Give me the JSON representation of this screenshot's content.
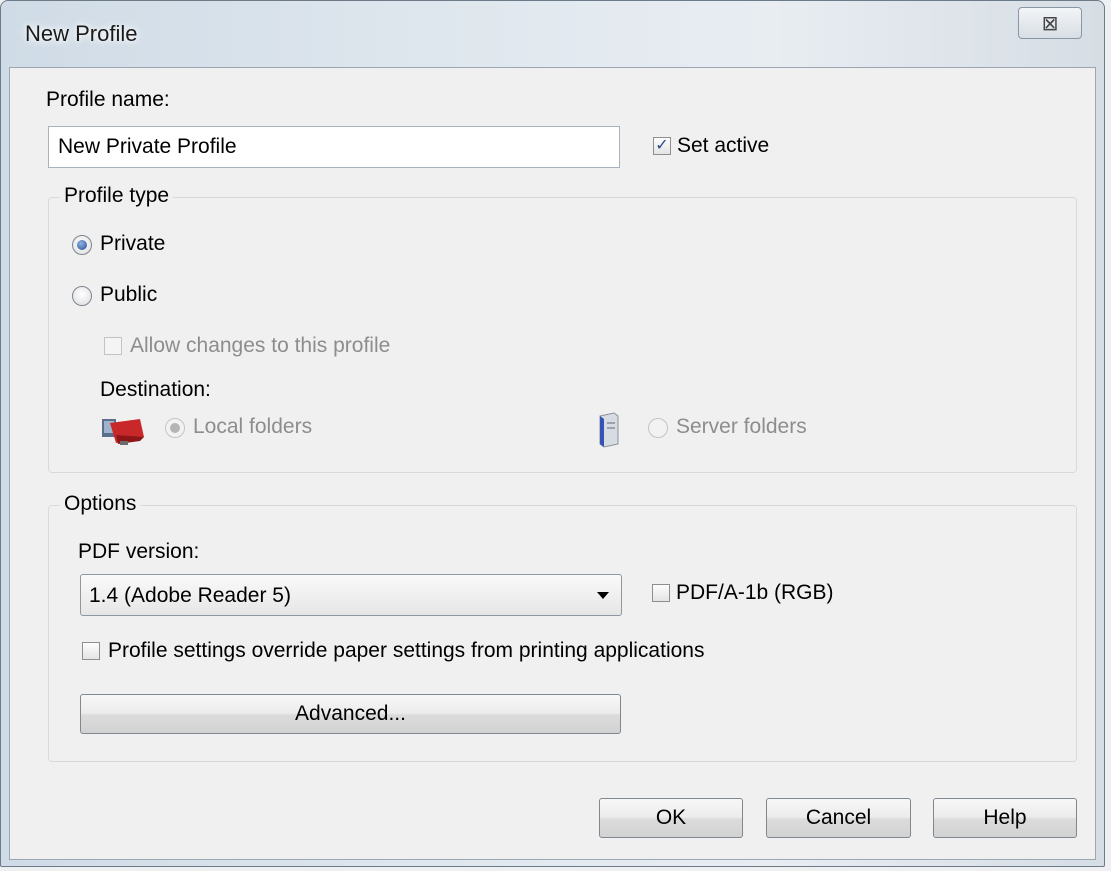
{
  "window": {
    "title": "New Profile",
    "close_glyph": "⊠"
  },
  "profile_name": {
    "label": "Profile name:",
    "value": "New Private Profile"
  },
  "set_active": {
    "label": "Set active",
    "checked": true
  },
  "profile_type": {
    "title": "Profile type",
    "private_label": "Private",
    "public_label": "Public",
    "selected": "Private",
    "allow_changes_label": "Allow changes to this profile",
    "destination_label": "Destination:",
    "local_folders_label": "Local folders",
    "server_folders_label": "Server folders"
  },
  "options": {
    "title": "Options",
    "pdf_version_label": "PDF version:",
    "pdf_version_value": "1.4 (Adobe Reader 5)",
    "pdfa_label": "PDF/A-1b (RGB)",
    "override_label": "Profile settings override paper settings from printing applications",
    "advanced_label": "Advanced..."
  },
  "buttons": {
    "ok": "OK",
    "cancel": "Cancel",
    "help": "Help"
  },
  "icons": {
    "local": "local-folders-icon",
    "server": "server-icon",
    "check": "✓"
  },
  "colors": {
    "accent": "#244d8f",
    "disabled_text": "#8d8d8d"
  }
}
